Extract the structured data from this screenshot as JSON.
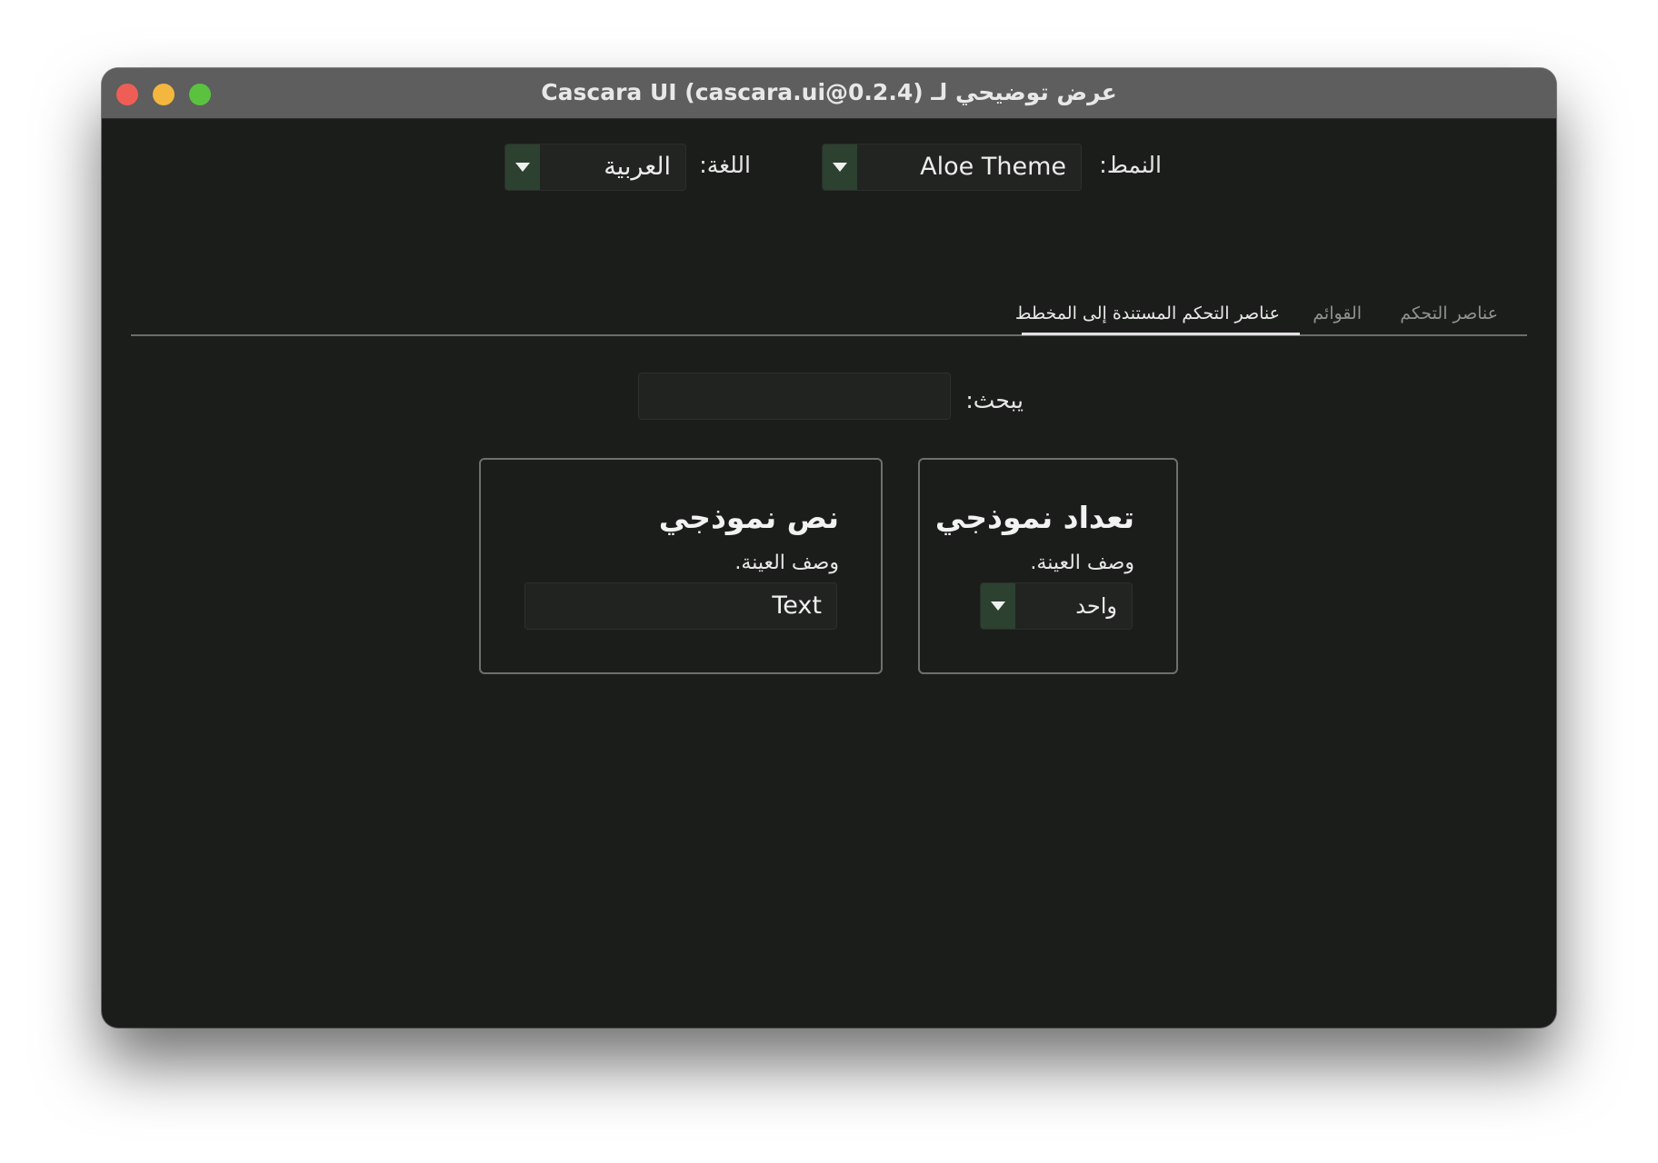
{
  "window": {
    "title": "عرض توضيحي لـ Cascara UI (cascara.ui@0.2.4)"
  },
  "toolbar": {
    "style_label": "النمط:",
    "style_value": "Aloe Theme",
    "language_label": "اللغة:",
    "language_value": "العربية"
  },
  "tabs": [
    {
      "label": "عناصر التحكم",
      "active": false
    },
    {
      "label": "القوائم",
      "active": false
    },
    {
      "label": "عناصر التحكم المستندة إلى المخطط",
      "active": true
    }
  ],
  "search": {
    "label": "يبحث:",
    "value": ""
  },
  "cards": {
    "enum": {
      "title": "تعداد نموذجي",
      "description": "وصف العينة.",
      "value": "واحد"
    },
    "text": {
      "title": "نص نموذجي",
      "description": "وصف العينة.",
      "value": "Text"
    }
  },
  "colors": {
    "background": "#1b1d1b",
    "titlebar": "#5d5e5d",
    "accent": "#2c4130",
    "close": "#ee5e56",
    "minimize": "#f3b73f",
    "maximize": "#5ac23f"
  }
}
